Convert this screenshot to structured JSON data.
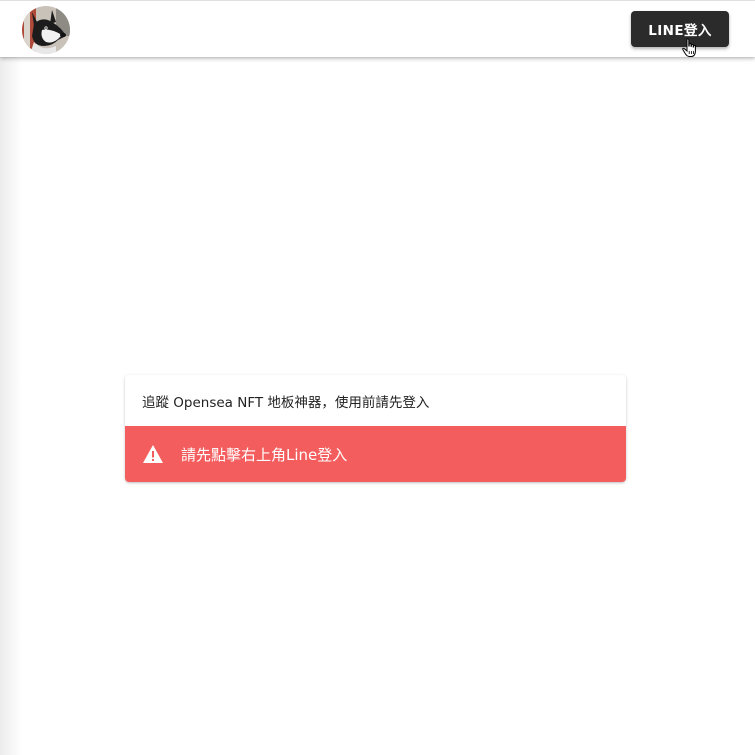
{
  "header": {
    "avatar_icon": "husky-avatar-icon",
    "login_button_label": "LINE登入"
  },
  "main": {
    "card_title": "追蹤 Opensea NFT 地板神器，使用前請先登入",
    "alert": {
      "icon": "warning-icon",
      "message": "請先點擊右上角Line登入",
      "color": "#f45d5e"
    }
  },
  "colors": {
    "button_bg": "#2b2b2b",
    "alert_bg": "#f45d5e"
  }
}
